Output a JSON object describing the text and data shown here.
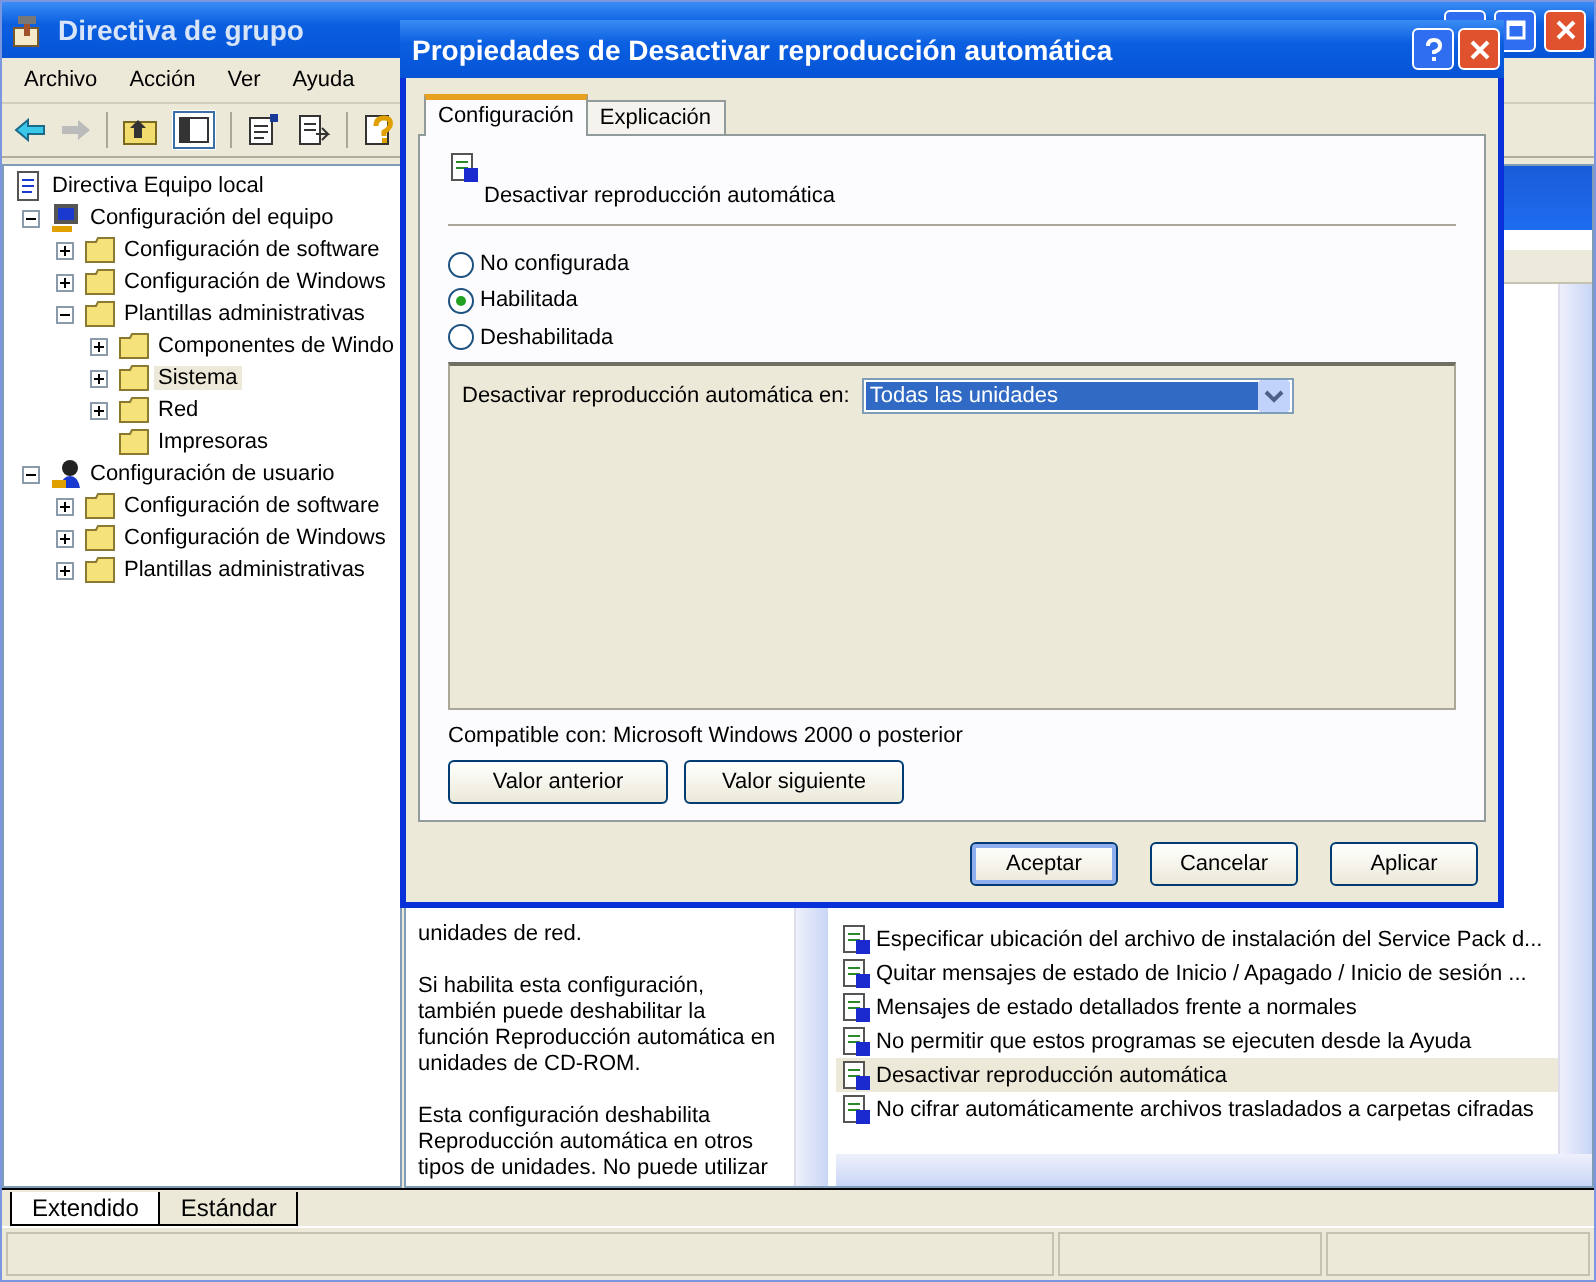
{
  "window": {
    "title": "Directiva de grupo"
  },
  "menu": [
    "Archivo",
    "Acción",
    "Ver",
    "Ayuda"
  ],
  "tree": [
    {
      "label": "Directiva Equipo local",
      "kind": "policy",
      "selected": false,
      "children": [
        {
          "label": "Configuración del equipo",
          "kind": "computer",
          "expandable": true,
          "expanded": true,
          "selected": false,
          "children": [
            {
              "label": "Configuración de software",
              "kind": "folder",
              "expandable": true,
              "expanded": false,
              "selected": false
            },
            {
              "label": "Configuración de Windows",
              "kind": "folder",
              "expandable": true,
              "expanded": false,
              "selected": false
            },
            {
              "label": "Plantillas administrativas",
              "kind": "folder",
              "expandable": true,
              "expanded": true,
              "selected": false,
              "children": [
                {
                  "label": "Componentes de Windo",
                  "kind": "folder",
                  "expandable": true,
                  "expanded": false,
                  "selected": false
                },
                {
                  "label": "Sistema",
                  "kind": "folder",
                  "expandable": true,
                  "expanded": false,
                  "selected": true
                },
                {
                  "label": "Red",
                  "kind": "folder",
                  "expandable": true,
                  "expanded": false,
                  "selected": false
                },
                {
                  "label": "Impresoras",
                  "kind": "folder",
                  "expandable": false,
                  "expanded": false,
                  "selected": false
                }
              ]
            }
          ]
        },
        {
          "label": "Configuración de usuario",
          "kind": "user",
          "expandable": true,
          "expanded": true,
          "selected": false,
          "children": [
            {
              "label": "Configuración de software",
              "kind": "folder",
              "expandable": true,
              "expanded": false,
              "selected": false
            },
            {
              "label": "Configuración de Windows",
              "kind": "folder",
              "expandable": true,
              "expanded": false,
              "selected": false
            },
            {
              "label": "Plantillas administrativas",
              "kind": "folder",
              "expandable": true,
              "expanded": false,
              "selected": false
            }
          ]
        }
      ]
    }
  ],
  "description": [
    "unidades de red.",
    "Si habilita esta configuración, también puede deshabilitar la función Reproducción automática en unidades de CD-ROM.",
    "Esta configuración deshabilita Reproducción automática en otros tipos de unidades. No puede utilizar"
  ],
  "settings": [
    {
      "label": "Especificar ubicación del archivo de instalación del Service Pack d...",
      "selected": false
    },
    {
      "label": "Quitar mensajes de estado de Inicio / Apagado / Inicio de sesión ...",
      "selected": false
    },
    {
      "label": "Mensajes de estado detallados frente a normales",
      "selected": false
    },
    {
      "label": "No permitir que estos programas se ejecuten desde la Ayuda",
      "selected": false
    },
    {
      "label": "Desactivar reproducción automática",
      "selected": true
    },
    {
      "label": "No cifrar automáticamente archivos trasladados a carpetas cifradas",
      "selected": false
    }
  ],
  "view_tabs": [
    {
      "label": "Extendido",
      "selected": true
    },
    {
      "label": "Estándar",
      "selected": false
    }
  ],
  "dialog": {
    "title": "Propiedades de Desactivar reproducción automática",
    "tabs": [
      {
        "label": "Configuración",
        "selected": true
      },
      {
        "label": "Explicación",
        "selected": false
      }
    ],
    "setting_name": "Desactivar reproducción automática",
    "options": [
      {
        "label": "No configurada",
        "selected": false
      },
      {
        "label": "Habilitada",
        "selected": true
      },
      {
        "label": "Deshabilitada",
        "selected": false
      }
    ],
    "dropdown": {
      "label": "Desactivar reproducción automática en:",
      "value": "Todas las unidades"
    },
    "compatibility": "Compatible con: Microsoft Windows 2000 o posterior",
    "nav_buttons": [
      "Valor anterior",
      "Valor siguiente"
    ],
    "buttons": [
      "Aceptar",
      "Cancelar",
      "Aplicar"
    ]
  }
}
